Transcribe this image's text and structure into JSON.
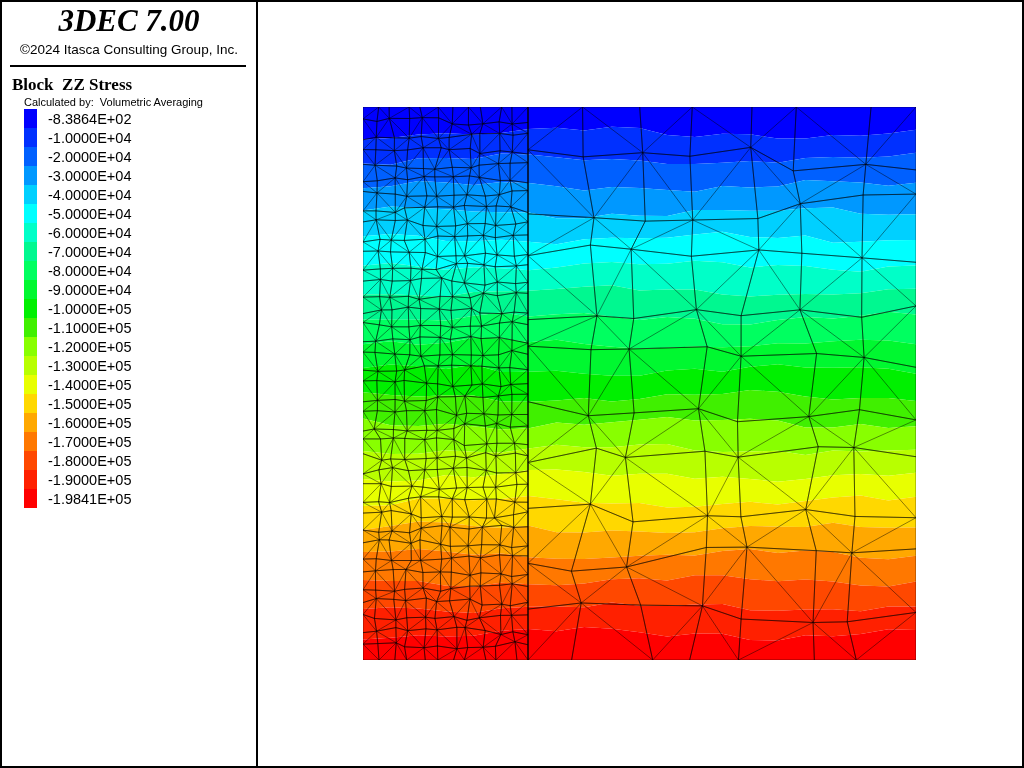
{
  "header": {
    "title": "3DEC 7.00",
    "copyright": "©2024 Itasca Consulting Group, Inc."
  },
  "legend": {
    "title": "Block  ZZ Stress",
    "subtitle": "Calculated by:  Volumetric Averaging",
    "items": [
      {
        "label": "-8.3864E+02",
        "color": "#0000ff"
      },
      {
        "label": "-1.0000E+04",
        "color": "#0030ff"
      },
      {
        "label": "-2.0000E+04",
        "color": "#0060ff"
      },
      {
        "label": "-3.0000E+04",
        "color": "#0098ff"
      },
      {
        "label": "-4.0000E+04",
        "color": "#00d0ff"
      },
      {
        "label": "-5.0000E+04",
        "color": "#00ffff"
      },
      {
        "label": "-6.0000E+04",
        "color": "#00ffc8"
      },
      {
        "label": "-7.0000E+04",
        "color": "#00f890"
      },
      {
        "label": "-8.0000E+04",
        "color": "#00ff60"
      },
      {
        "label": "-9.0000E+04",
        "color": "#00f830"
      },
      {
        "label": "-1.0000E+05",
        "color": "#00f000"
      },
      {
        "label": "-1.1000E+05",
        "color": "#40f000"
      },
      {
        "label": "-1.2000E+05",
        "color": "#88ff00"
      },
      {
        "label": "-1.3000E+05",
        "color": "#b8ff00"
      },
      {
        "label": "-1.4000E+05",
        "color": "#e8ff00"
      },
      {
        "label": "-1.5000E+05",
        "color": "#ffd800"
      },
      {
        "label": "-1.6000E+05",
        "color": "#ffa800"
      },
      {
        "label": "-1.7000E+05",
        "color": "#ff7800"
      },
      {
        "label": "-1.8000E+05",
        "color": "#ff4800"
      },
      {
        "label": "-1.9000E+05",
        "color": "#ff2000"
      },
      {
        "label": "-1.9841E+05",
        "color": "#ff0000"
      }
    ]
  }
}
